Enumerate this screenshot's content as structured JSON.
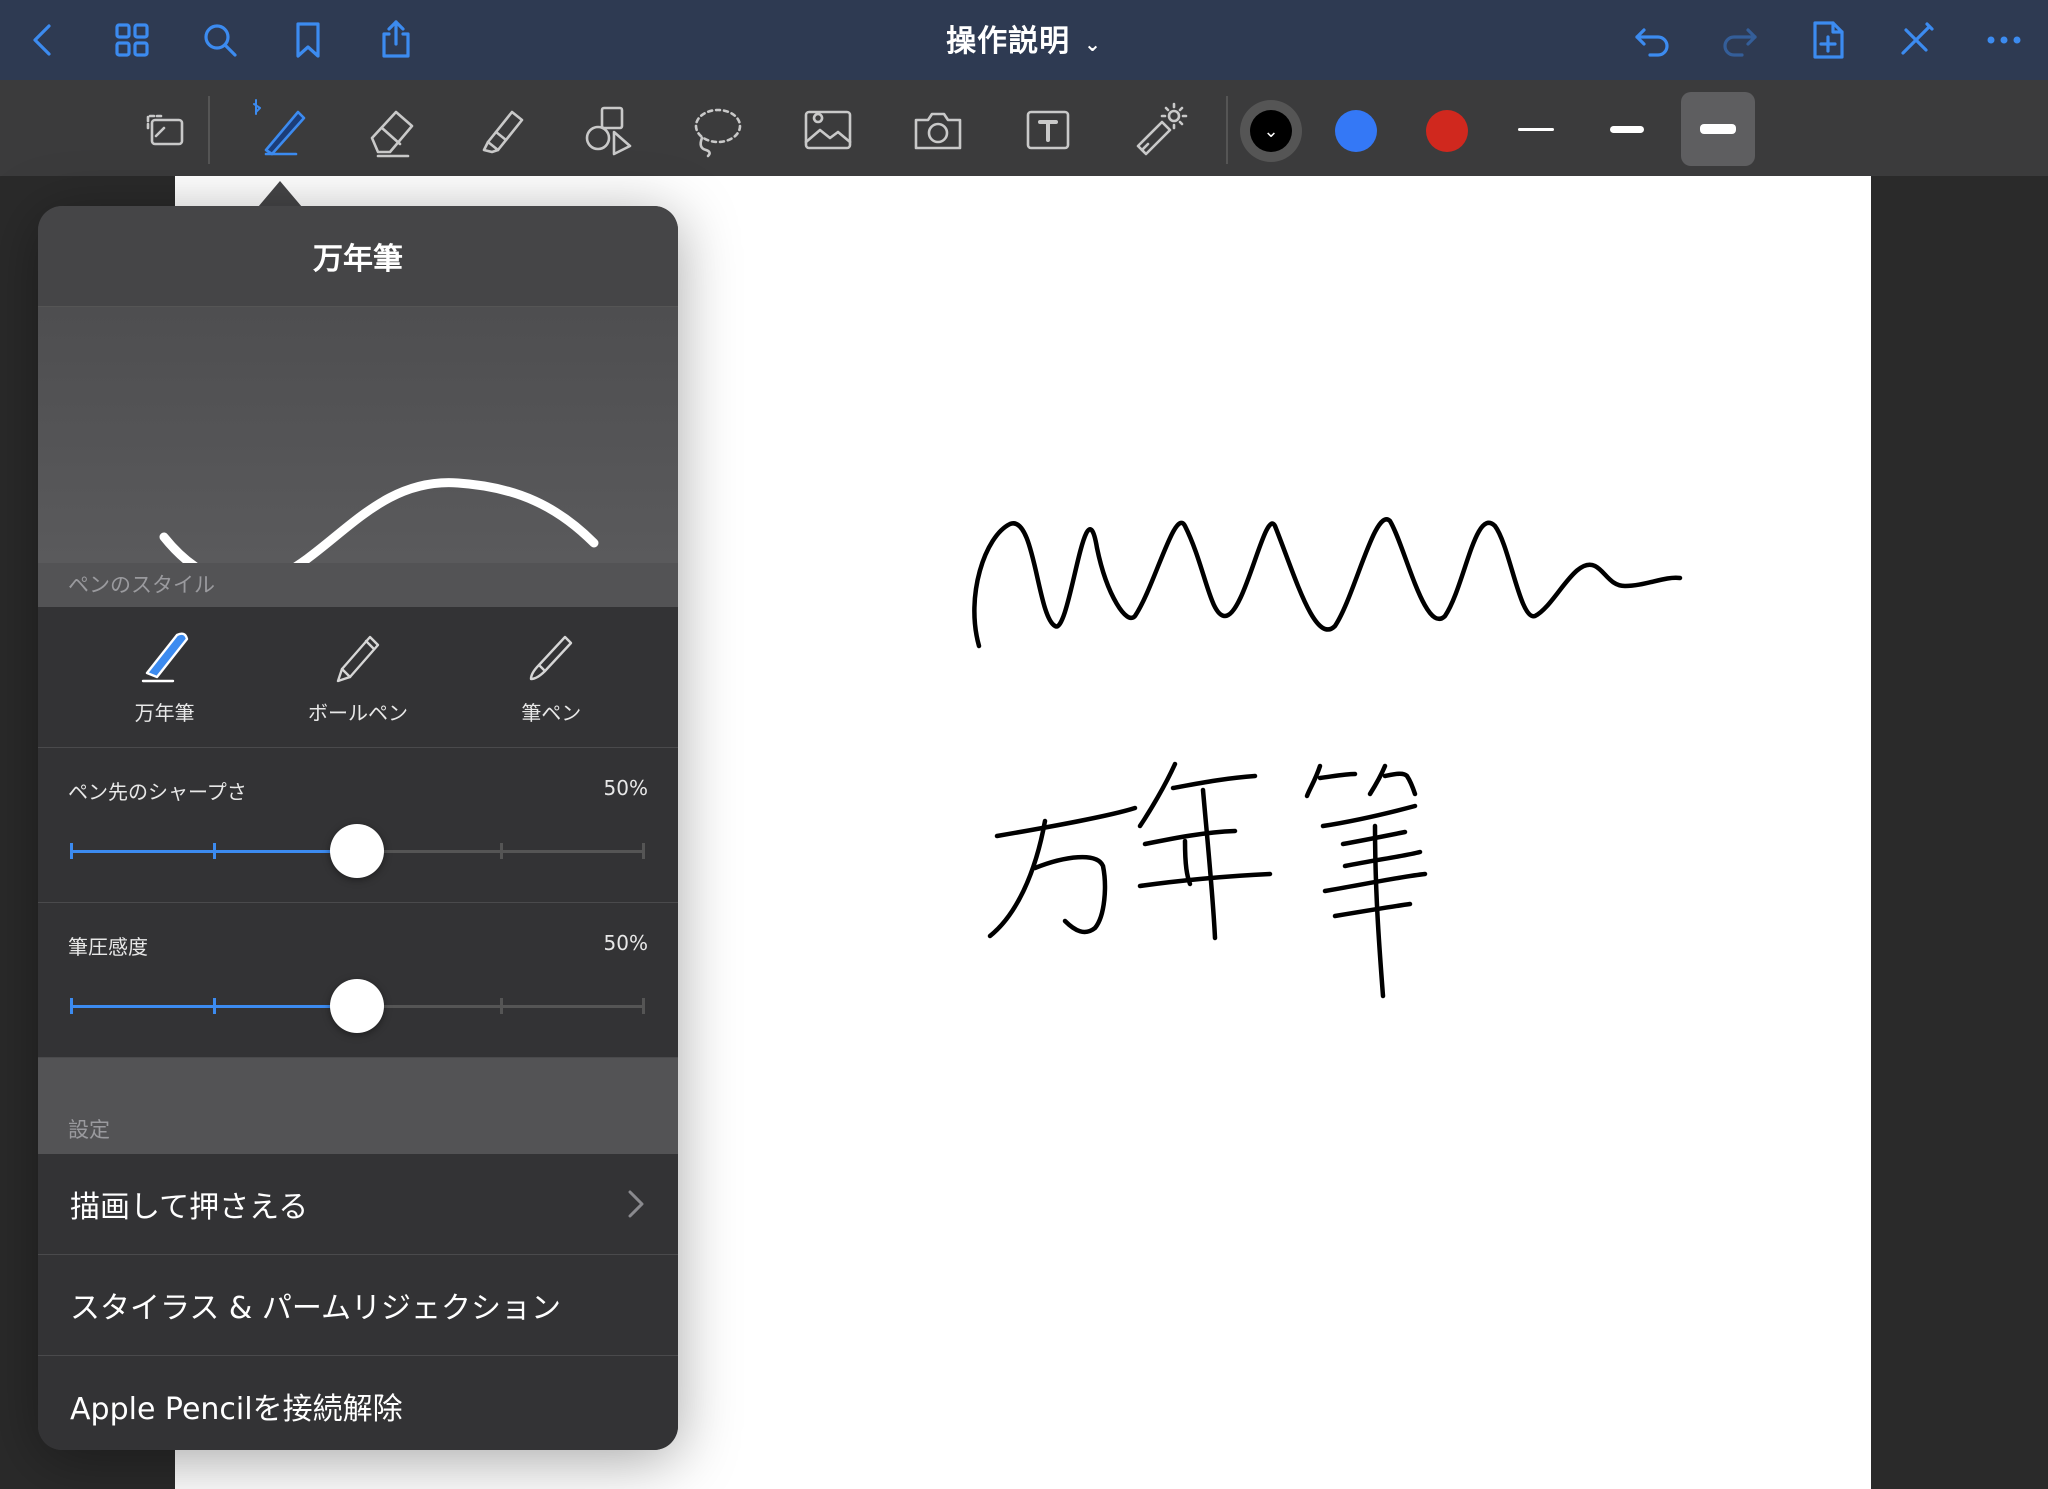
{
  "header": {
    "title": "操作説明",
    "accent_color": "#3c8bf0",
    "left_icons": [
      "back-icon",
      "grid-icon",
      "search-icon",
      "bookmark-icon",
      "share-icon"
    ],
    "right_icons": [
      "undo-icon",
      "redo-icon",
      "add-page-icon",
      "close-pen-icon",
      "more-icon"
    ]
  },
  "toolbar": {
    "tools": [
      "read-mode-icon",
      "pen-icon",
      "eraser-icon",
      "highlighter-icon",
      "shapes-icon",
      "lasso-icon",
      "image-icon",
      "camera-icon",
      "text-icon",
      "laser-pointer-icon"
    ],
    "selected_tool": "pen-icon",
    "colors": [
      "#000000",
      "#3478f6",
      "#d0281e"
    ],
    "selected_color": "#000000",
    "thickness_options": [
      "thin",
      "medium",
      "thick"
    ],
    "selected_thickness": "thick"
  },
  "popover": {
    "title": "万年筆",
    "style_section_label": "ペンのスタイル",
    "styles": [
      {
        "label": "万年筆",
        "icon": "fountain-pen-icon"
      },
      {
        "label": "ボールペン",
        "icon": "ballpoint-pen-icon"
      },
      {
        "label": "筆ペン",
        "icon": "brush-pen-icon"
      }
    ],
    "selected_style": "万年筆",
    "sharpness": {
      "label": "ペン先のシャープさ",
      "value": "50%",
      "level": 0.5
    },
    "pressure": {
      "label": "筆圧感度",
      "value": "50%",
      "level": 0.5
    },
    "settings_label": "設定",
    "settings": [
      {
        "label": "描画して押さえる",
        "has_chevron": true
      },
      {
        "label": "スタイラス & パームリジェクション",
        "has_chevron": false
      },
      {
        "label": "Apple Pencilを接続解除",
        "has_chevron": false
      }
    ]
  }
}
